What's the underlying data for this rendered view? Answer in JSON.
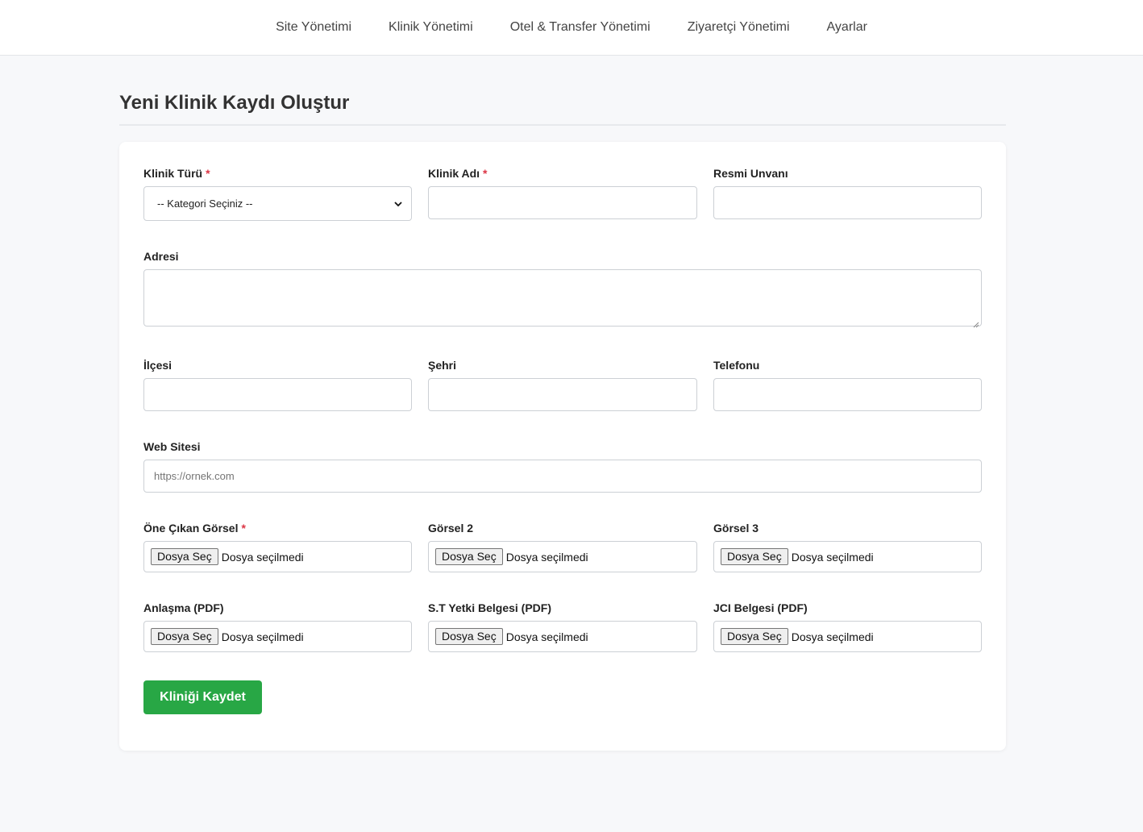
{
  "nav": {
    "items": [
      {
        "label": "Site Yönetimi"
      },
      {
        "label": "Klinik Yönetimi"
      },
      {
        "label": "Otel & Transfer Yönetimi"
      },
      {
        "label": "Ziyaretçi Yönetimi"
      },
      {
        "label": "Ayarlar"
      }
    ]
  },
  "page": {
    "title": "Yeni Klinik Kaydı Oluştur"
  },
  "form": {
    "required_marker": "*",
    "clinic_type": {
      "label": "Klinik Türü",
      "selected": "-- Kategori Seçiniz --"
    },
    "clinic_name": {
      "label": "Klinik Adı",
      "value": ""
    },
    "official_title": {
      "label": "Resmi Unvanı",
      "value": ""
    },
    "address": {
      "label": "Adresi",
      "value": ""
    },
    "district": {
      "label": "İlçesi",
      "value": ""
    },
    "city": {
      "label": "Şehri",
      "value": ""
    },
    "phone": {
      "label": "Telefonu",
      "value": ""
    },
    "website": {
      "label": "Web Sitesi",
      "placeholder": "https://ornek.com",
      "value": ""
    },
    "file_button_label": "Dosya Seç",
    "file_status": "Dosya seçilmedi",
    "files": [
      {
        "label": "Öne Çıkan Görsel"
      },
      {
        "label": "Görsel 2"
      },
      {
        "label": "Görsel 3"
      },
      {
        "label": "Anlaşma (PDF)"
      },
      {
        "label": "S.T Yetki Belgesi (PDF)"
      },
      {
        "label": "JCI Belgesi (PDF)"
      }
    ],
    "submit_label": "Kliniği Kaydet"
  },
  "colors": {
    "primary_button": "#28a745",
    "required": "#dc3545",
    "page_background": "#f7f8fa"
  },
  "icons": {
    "select_arrow": "chevron-down-icon",
    "textarea_resize": "resize-grip-icon"
  }
}
